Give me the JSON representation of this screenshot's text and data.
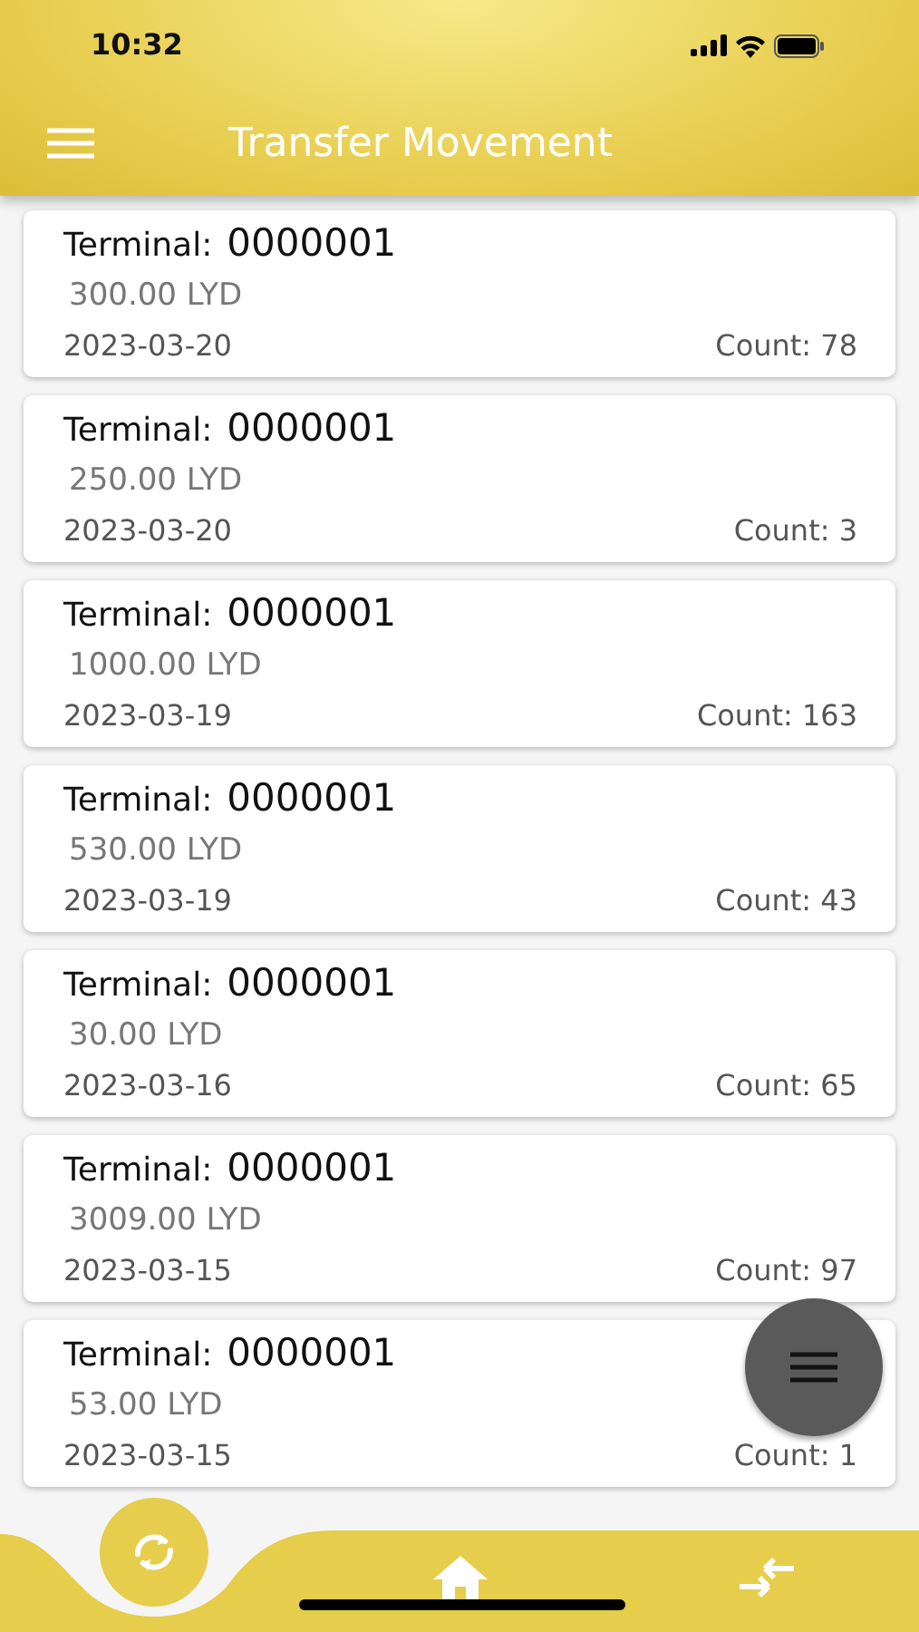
{
  "status_bar": {
    "time": "10:32"
  },
  "header": {
    "title": "Transfer Movement"
  },
  "transactions": [
    {
      "label": "Terminal:",
      "terminal": "0000001",
      "amount": "300.00 LYD",
      "date": "2023-03-20",
      "count": "Count: 78"
    },
    {
      "label": "Terminal:",
      "terminal": "0000001",
      "amount": "250.00 LYD",
      "date": "2023-03-20",
      "count": "Count: 3"
    },
    {
      "label": "Terminal:",
      "terminal": "0000001",
      "amount": "1000.00 LYD",
      "date": "2023-03-19",
      "count": "Count: 163"
    },
    {
      "label": "Terminal:",
      "terminal": "0000001",
      "amount": "530.00 LYD",
      "date": "2023-03-19",
      "count": "Count: 43"
    },
    {
      "label": "Terminal:",
      "terminal": "0000001",
      "amount": "30.00 LYD",
      "date": "2023-03-16",
      "count": "Count: 65"
    },
    {
      "label": "Terminal:",
      "terminal": "0000001",
      "amount": "3009.00 LYD",
      "date": "2023-03-15",
      "count": "Count: 97"
    },
    {
      "label": "Terminal:",
      "terminal": "0000001",
      "amount": "53.00 LYD",
      "date": "2023-03-15",
      "count": "Count: 1"
    }
  ],
  "bottom_nav": [
    {
      "kind": "refresh",
      "selected": true
    },
    {
      "kind": "home",
      "selected": false
    },
    {
      "kind": "transfer",
      "selected": false
    }
  ]
}
